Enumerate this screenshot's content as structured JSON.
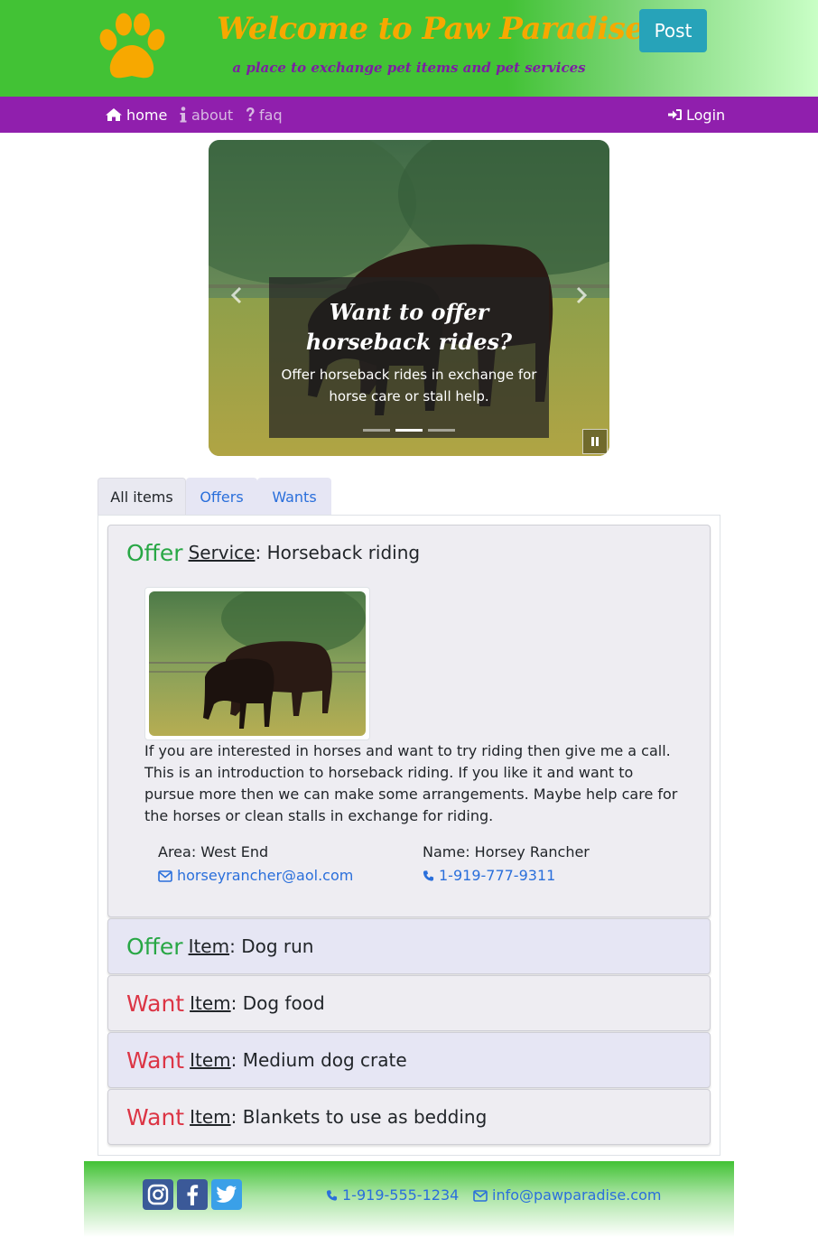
{
  "header": {
    "title": "Welcome to Paw Paradise",
    "tagline": "a place to exchange pet items and pet services",
    "post_label": "Post",
    "logo_icon": "paw-icon",
    "title_color": "#f7a800"
  },
  "nav": {
    "items": [
      {
        "label": "home",
        "icon": "home-icon",
        "active": true
      },
      {
        "label": "about",
        "icon": "info-icon",
        "active": false
      },
      {
        "label": "faq",
        "icon": "question-icon",
        "active": false
      }
    ],
    "login_label": "Login",
    "background": "#901fad"
  },
  "carousel": {
    "caption_title": "Want to offer horseback rides?",
    "caption_text": "Offer horseback rides in exchange for horse care or stall help.",
    "slide_count": 3,
    "active_slide": 2
  },
  "tabs": [
    {
      "label": "All items",
      "active": true
    },
    {
      "label": "Offers",
      "active": false
    },
    {
      "label": "Wants",
      "active": false
    }
  ],
  "listings": [
    {
      "kind": "Offer",
      "category": "Service",
      "title": "Horseback riding",
      "expanded": true,
      "description": "If you are interested in horses and want to try riding then give me a call. This is an introduction to horseback riding. If you like it and want to pursue more then we can make some arrangements. Maybe help care for the horses or clean stalls in exchange for riding.",
      "area_label": "Area: West End",
      "name_label": "Name: Horsey Rancher",
      "email": "horseyrancher@aol.com",
      "phone": "1-919-777-9311"
    },
    {
      "kind": "Offer",
      "category": "Item",
      "title": "Dog run"
    },
    {
      "kind": "Want",
      "category": "Item",
      "title": "Dog food"
    },
    {
      "kind": "Want",
      "category": "Item",
      "title": "Medium dog crate"
    },
    {
      "kind": "Want",
      "category": "Item",
      "title": "Blankets to use as bedding"
    }
  ],
  "footer": {
    "phone": "1-919-555-1234",
    "email": "info@pawparadise.com",
    "social": [
      "instagram-icon",
      "facebook-icon",
      "twitter-icon"
    ]
  },
  "colors": {
    "offer": "#28a745",
    "want": "#dc3545",
    "link": "#2a6fdb"
  }
}
